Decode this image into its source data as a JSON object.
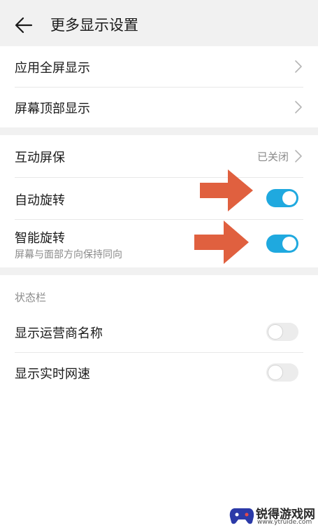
{
  "header": {
    "title": "更多显示设置"
  },
  "group1": {
    "items": [
      {
        "label": "应用全屏显示"
      },
      {
        "label": "屏幕顶部显示"
      }
    ]
  },
  "group2": {
    "items": [
      {
        "label": "互动屏保",
        "value": "已关闭"
      },
      {
        "label": "自动旋转",
        "toggle": true
      },
      {
        "label": "智能旋转",
        "sublabel": "屏幕与面部方向保持同向",
        "toggle": true
      }
    ]
  },
  "group3": {
    "section_label": "状态栏",
    "items": [
      {
        "label": "显示运营商名称",
        "toggle": false
      },
      {
        "label": "显示实时网速",
        "toggle": false
      }
    ]
  },
  "colors": {
    "toggle_on": "#1fa9df",
    "toggle_off": "#ececec",
    "annotation_arrow": "#e0603f"
  },
  "watermark": {
    "title": "锐得游戏网",
    "url": "www.ytruide.com"
  }
}
